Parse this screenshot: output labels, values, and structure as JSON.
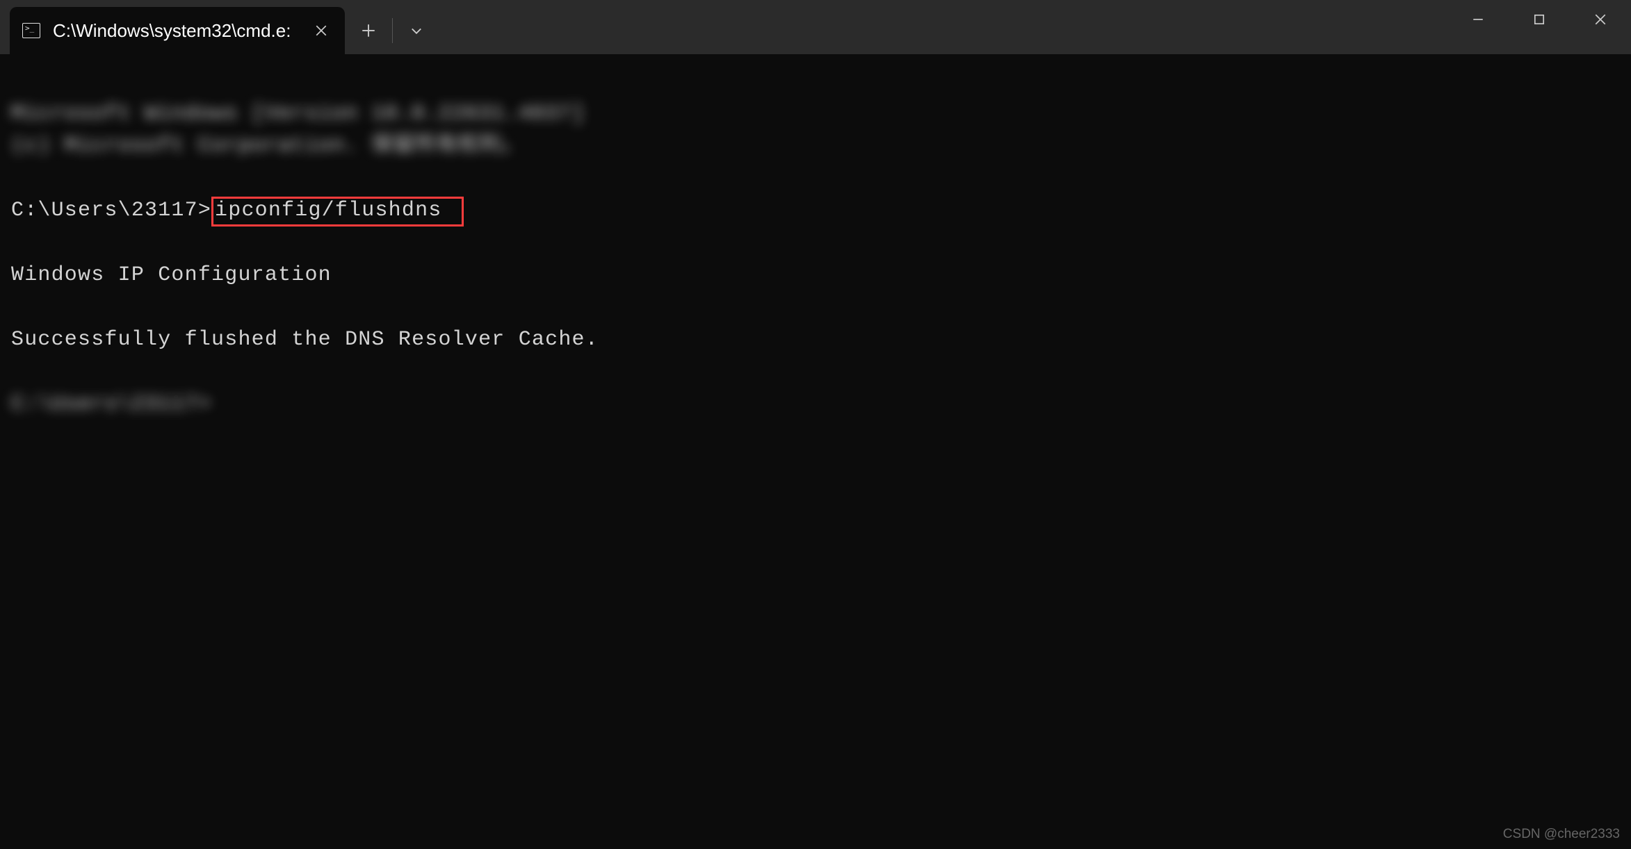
{
  "titlebar": {
    "tab_title": "C:\\Windows\\system32\\cmd.e:"
  },
  "terminal": {
    "blurred_line1": "Microsoft Windows [Version 10.0.22631.4037]",
    "blurred_line2": "(c) Microsoft Corporation. 保留所有权利。",
    "prompt": "C:\\Users\\23117>",
    "command": "ipconfig/flushdns",
    "output_heading": "Windows IP Configuration",
    "output_message": "Successfully flushed the DNS Resolver Cache.",
    "blurred_prompt": "C:\\Users\\23117>"
  },
  "watermark": "CSDN @cheer2333"
}
